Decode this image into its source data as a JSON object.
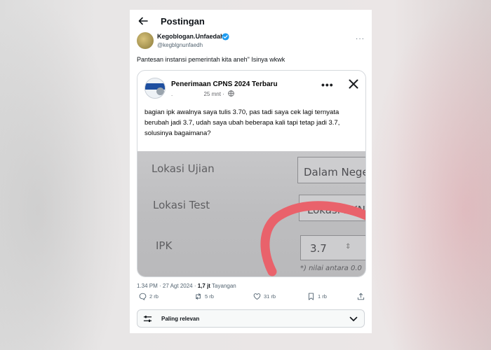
{
  "header": {
    "title": "Postingan"
  },
  "author": {
    "name": "Kegoblogan.Unfaedah",
    "handle": "@kegblgnunfaedh"
  },
  "tweet": {
    "text": "Pantesan instansi pemerintah kita aneh\" Isinya wkwk"
  },
  "embedded_post": {
    "title": "Penerimaan CPNS 2024 Terbaru",
    "author_dot": ".",
    "time": "25 mnt ·",
    "text": "bagian ipk awalnya saya tulis 3.70, pas tadi saya cek lagi ternyata berubah jadi 3.7, udah saya ubah beberapa kali tapi tetap jadi 3.7, solusinya bagaimana?",
    "photo": {
      "label_1": "Lokasi Ujian",
      "label_2": "Lokasi Test",
      "label_3": "IPK",
      "field_1": "Dalam Nege",
      "field_2": "Lokasi BKN",
      "field_3": "3.7",
      "note": "*) nilai antara 0.0"
    }
  },
  "meta": {
    "timestamp": "1.34 PM · 27 Agt 2024 ·",
    "views": "1,7 jt",
    "views_label": "Tayangan"
  },
  "actions": {
    "replies": "2 rb",
    "reposts": "5 rb",
    "likes": "31 rb",
    "bookmarks": "1 rb"
  },
  "sort": {
    "label": "Paling relevan"
  },
  "colors": {
    "accent": "#1d9bf0",
    "highlight_stroke": "#e9626b"
  }
}
